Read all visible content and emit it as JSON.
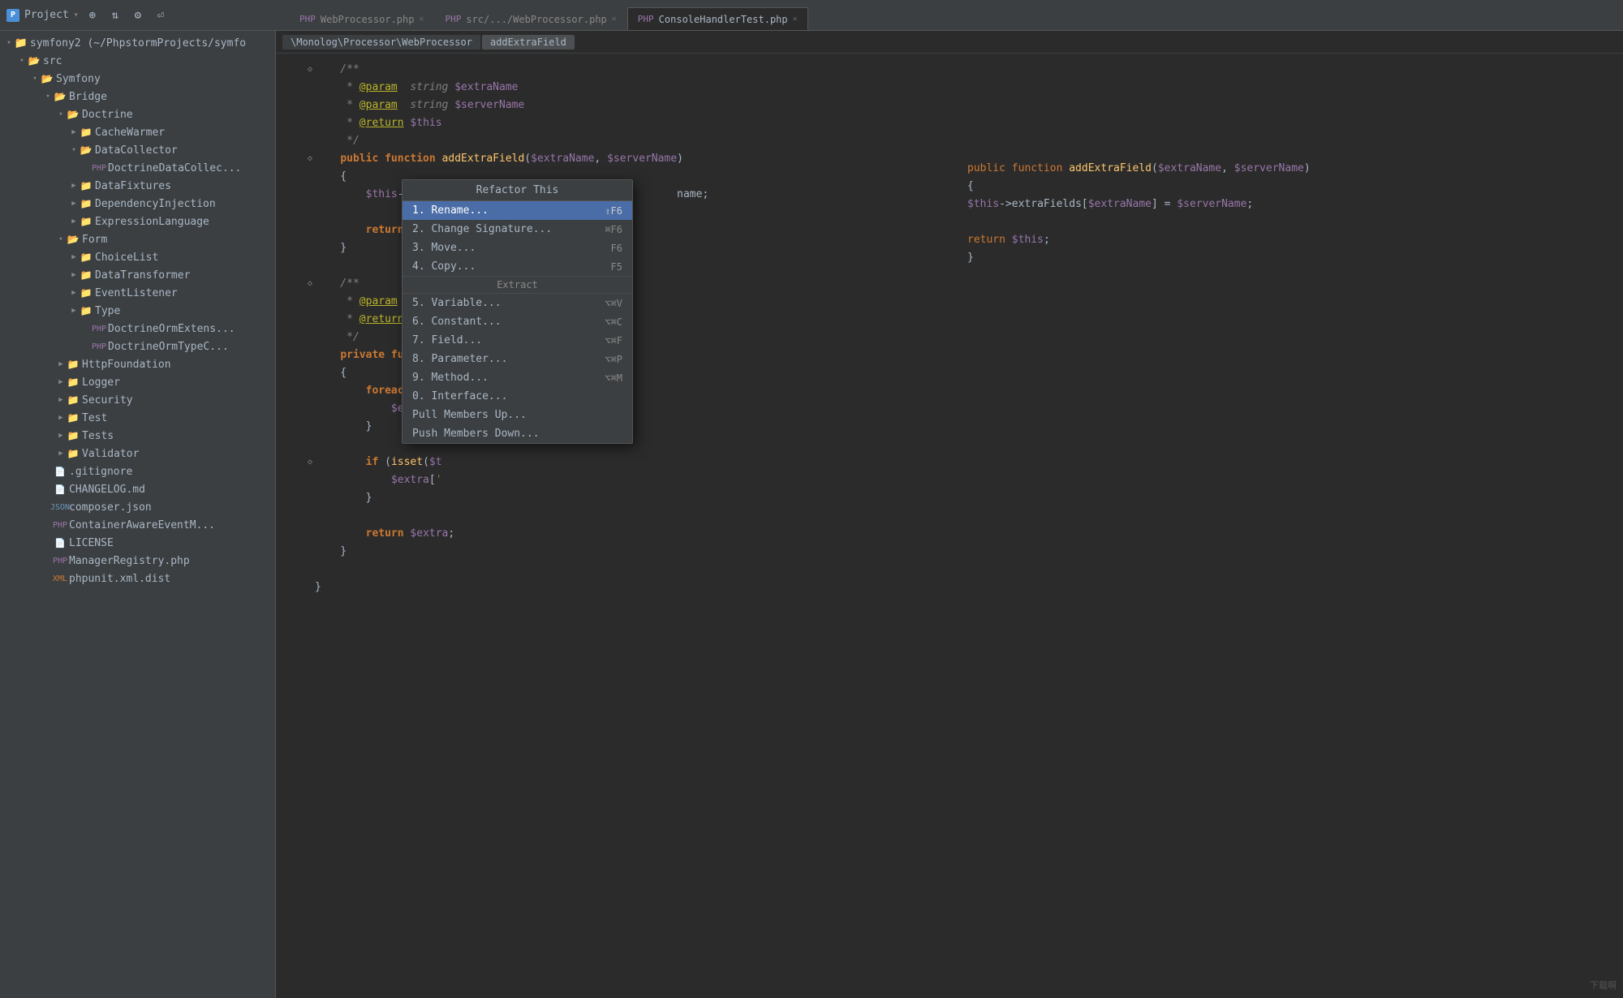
{
  "titlebar": {
    "project_label": "Project",
    "dropdown_arrow": "▾",
    "icons": [
      "⊕",
      "⇅",
      "⚙",
      "⏎"
    ]
  },
  "tabs": [
    {
      "label": "WebProcessor.php",
      "active": false,
      "id": "tab1"
    },
    {
      "label": "src/.../WebProcessor.php",
      "active": false,
      "id": "tab2"
    },
    {
      "label": "ConsoleHandlerTest.php",
      "active": true,
      "id": "tab3"
    }
  ],
  "breadcrumb": {
    "segments": [
      "\\Monolog\\Processor\\WebProcessor",
      "addExtraField"
    ]
  },
  "sidebar": {
    "title": "Project",
    "items": [
      {
        "id": "symfony2",
        "label": "symfony2 (~/PhpstormProjects/symfo",
        "type": "project",
        "indent": 0,
        "expanded": true
      },
      {
        "id": "src",
        "label": "src",
        "type": "folder",
        "indent": 1,
        "expanded": true
      },
      {
        "id": "symfony",
        "label": "Symfony",
        "type": "folder",
        "indent": 2,
        "expanded": true
      },
      {
        "id": "bridge",
        "label": "Bridge",
        "type": "folder",
        "indent": 3,
        "expanded": true
      },
      {
        "id": "doctrine",
        "label": "Doctrine",
        "type": "folder",
        "indent": 4,
        "expanded": true
      },
      {
        "id": "cachewarmer",
        "label": "CacheWarmer",
        "type": "folder",
        "indent": 5,
        "expanded": false
      },
      {
        "id": "datacollector",
        "label": "DataCollector",
        "type": "folder",
        "indent": 5,
        "expanded": true
      },
      {
        "id": "doctrinedatacollect",
        "label": "DoctrineDataCollec...",
        "type": "file-php",
        "indent": 6
      },
      {
        "id": "datafixtures",
        "label": "DataFixtures",
        "type": "folder",
        "indent": 5,
        "expanded": false
      },
      {
        "id": "dependencyinjection",
        "label": "DependencyInjection",
        "type": "folder",
        "indent": 5,
        "expanded": false
      },
      {
        "id": "expressionlanguage",
        "label": "ExpressionLanguage",
        "type": "folder",
        "indent": 5,
        "expanded": false
      },
      {
        "id": "form",
        "label": "Form",
        "type": "folder",
        "indent": 4,
        "expanded": true
      },
      {
        "id": "choicelist",
        "label": "ChoiceList",
        "type": "folder",
        "indent": 5,
        "expanded": false
      },
      {
        "id": "datatransformer",
        "label": "DataTransformer",
        "type": "folder",
        "indent": 5,
        "expanded": false
      },
      {
        "id": "eventlistener",
        "label": "EventListener",
        "type": "folder",
        "indent": 5,
        "expanded": false
      },
      {
        "id": "type",
        "label": "Type",
        "type": "folder",
        "indent": 5,
        "expanded": false
      },
      {
        "id": "doctrineormextens",
        "label": "DoctrineOrmExtens...",
        "type": "file-php",
        "indent": 6
      },
      {
        "id": "doctrineormtypec",
        "label": "DoctrineOrmTypeC...",
        "type": "file-php",
        "indent": 6
      },
      {
        "id": "httpfoundation",
        "label": "HttpFoundation",
        "type": "folder",
        "indent": 4,
        "expanded": false
      },
      {
        "id": "logger",
        "label": "Logger",
        "type": "folder",
        "indent": 4,
        "expanded": false
      },
      {
        "id": "security",
        "label": "Security",
        "type": "folder",
        "indent": 4,
        "expanded": false
      },
      {
        "id": "test",
        "label": "Test",
        "type": "folder",
        "indent": 4,
        "expanded": false
      },
      {
        "id": "tests",
        "label": "Tests",
        "type": "folder",
        "indent": 4,
        "expanded": false
      },
      {
        "id": "validator",
        "label": "Validator",
        "type": "folder",
        "indent": 4,
        "expanded": false
      },
      {
        "id": "gitignore",
        "label": ".gitignore",
        "type": "file-text",
        "indent": 3
      },
      {
        "id": "changelog",
        "label": "CHANGELOG.md",
        "type": "file-text",
        "indent": 3
      },
      {
        "id": "composerjson",
        "label": "composer.json",
        "type": "file-json",
        "indent": 3
      },
      {
        "id": "containeraware",
        "label": "ContainerAwareEventM...",
        "type": "file-php",
        "indent": 3
      },
      {
        "id": "license",
        "label": "LICENSE",
        "type": "file-text",
        "indent": 3
      },
      {
        "id": "managerregistry",
        "label": "ManagerRegistry.php",
        "type": "file-php",
        "indent": 3
      },
      {
        "id": "phpunitxml",
        "label": "phpunit.xml.dist",
        "type": "file-xml",
        "indent": 3
      }
    ]
  },
  "code": {
    "lines": [
      {
        "num": "",
        "marker": "",
        "content": ""
      },
      {
        "num": "",
        "marker": "◇",
        "content": "    /**"
      },
      {
        "num": "",
        "marker": "",
        "content": "     * @param  string $extraName"
      },
      {
        "num": "",
        "marker": "",
        "content": "     * @param  string $serverName"
      },
      {
        "num": "",
        "marker": "",
        "content": "     * @return $this"
      },
      {
        "num": "",
        "marker": "",
        "content": "     */"
      },
      {
        "num": "",
        "marker": "◇",
        "content": "    public function addExtraField($extraName, $serverName)"
      },
      {
        "num": "",
        "marker": "",
        "content": "    {"
      },
      {
        "num": "",
        "marker": "",
        "content": "        $this->extra[                                    name;"
      },
      {
        "num": "",
        "marker": "",
        "content": ""
      },
      {
        "num": "",
        "marker": "",
        "content": "        return $thi"
      },
      {
        "num": "",
        "marker": "",
        "content": "    }"
      },
      {
        "num": "",
        "marker": "",
        "content": ""
      },
      {
        "num": "",
        "marker": "◇",
        "content": "    /**"
      },
      {
        "num": "",
        "marker": "",
        "content": "     * @param  array"
      },
      {
        "num": "",
        "marker": "",
        "content": "     * @return array"
      },
      {
        "num": "",
        "marker": "",
        "content": "     */"
      },
      {
        "num": "",
        "marker": "",
        "content": "    private function"
      },
      {
        "num": "",
        "marker": "",
        "content": "    {"
      },
      {
        "num": "",
        "marker": "",
        "content": "        foreach ($th"
      },
      {
        "num": "",
        "marker": "",
        "content": "            $extra[$"
      },
      {
        "num": "",
        "marker": "",
        "content": "        }"
      },
      {
        "num": "",
        "marker": "",
        "content": ""
      },
      {
        "num": "",
        "marker": "◇",
        "content": "        if (isset($t"
      },
      {
        "num": "",
        "marker": "",
        "content": "            $extra['"
      },
      {
        "num": "",
        "marker": "",
        "content": "        }"
      },
      {
        "num": "",
        "marker": "",
        "content": ""
      },
      {
        "num": "",
        "marker": "",
        "content": "        return $extra;"
      },
      {
        "num": "",
        "marker": "",
        "content": "    }"
      },
      {
        "num": "",
        "marker": "",
        "content": ""
      },
      {
        "num": "",
        "marker": "",
        "content": "}"
      }
    ]
  },
  "popup": {
    "title": "Refactor This",
    "items": [
      {
        "label": "1. Rename...",
        "shortcut": "⇧F6",
        "selected": true
      },
      {
        "label": "2. Change Signature...",
        "shortcut": "⌘F6",
        "selected": false
      },
      {
        "label": "3. Move...",
        "shortcut": "F6",
        "selected": false
      },
      {
        "label": "4. Copy...",
        "shortcut": "F5",
        "selected": false
      }
    ],
    "extract_title": "Extract",
    "extract_items": [
      {
        "label": "5. Variable...",
        "shortcut": "⌥⌘V",
        "selected": false
      },
      {
        "label": "6. Constant...",
        "shortcut": "⌥⌘C",
        "selected": false
      },
      {
        "label": "7. Field...",
        "shortcut": "⌥⌘F",
        "selected": false
      },
      {
        "label": "8. Parameter...",
        "shortcut": "⌥⌘P",
        "selected": false
      },
      {
        "label": "9. Method...",
        "shortcut": "⌥⌘M",
        "selected": false
      },
      {
        "label": "0. Interface...",
        "shortcut": "",
        "selected": false
      }
    ],
    "other_items": [
      {
        "label": "Pull Members Up...",
        "shortcut": ""
      },
      {
        "label": "Push Members Down...",
        "shortcut": ""
      }
    ]
  },
  "watermark": "下载啊"
}
